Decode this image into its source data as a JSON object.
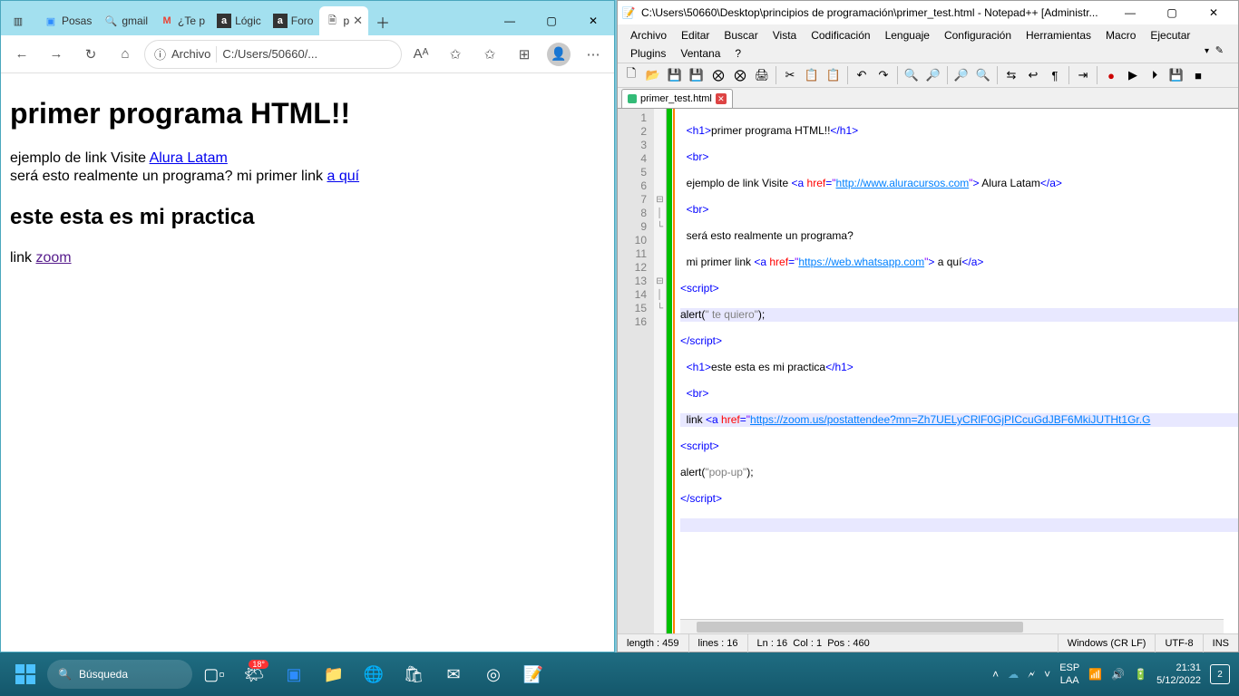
{
  "browser": {
    "tabs": [
      {
        "label": "",
        "icon": "▥"
      },
      {
        "label": "Posas",
        "icon": "📹",
        "color": "#2d8cff"
      },
      {
        "label": "gmail",
        "icon": "🔍",
        "color": "#00a1f1"
      },
      {
        "label": "¿Te p",
        "icon": "M",
        "color": "#ea4335"
      },
      {
        "label": "Lógic",
        "icon": "a",
        "color": "#333"
      },
      {
        "label": "Foro",
        "icon": "a",
        "color": "#333"
      },
      {
        "label": "p",
        "icon": "🗎",
        "active": true
      }
    ],
    "toolbar": {
      "back": "←",
      "fwd": "→",
      "reload": "↻",
      "home": "⌂",
      "addr_label": "Archivo",
      "addr_path": "C:/Users/50660/...",
      "read": "Aᴬ",
      "fav": "✩",
      "coll": "✩",
      "ext": "⊞",
      "more": "⋯"
    },
    "page": {
      "h1": "primer programa HTML!!",
      "line1a": "ejemplo de link Visite ",
      "link1": "Alura Latam",
      "line2a": "será esto realmente un programa? mi primer link ",
      "link2": "a quí",
      "h2": "este esta es mi practica",
      "line3a": "link ",
      "link3": "zoom"
    }
  },
  "npp": {
    "title": "C:\\Users\\50660\\Desktop\\principios de programación\\primer_test.html - Notepad++ [Administr...",
    "menus": [
      "Archivo",
      "Editar",
      "Buscar",
      "Vista",
      "Codificación",
      "Lenguaje",
      "Configuración",
      "Herramientas",
      "Macro",
      "Ejecutar",
      "Plugins",
      "Ventana",
      "?"
    ],
    "tab": "primer_test.html",
    "status": {
      "len": "length : 459",
      "lines": "lines : 16",
      "ln": "Ln : 16",
      "col": "Col : 1",
      "pos": "Pos : 460",
      "eol": "Windows (CR LF)",
      "enc": "UTF-8",
      "ins": "INS"
    }
  },
  "taskbar": {
    "search": "Búsqueda",
    "lang1": "ESP",
    "lang2": "LAA",
    "time": "21:31",
    "date": "5/12/2022",
    "notif": "2"
  }
}
